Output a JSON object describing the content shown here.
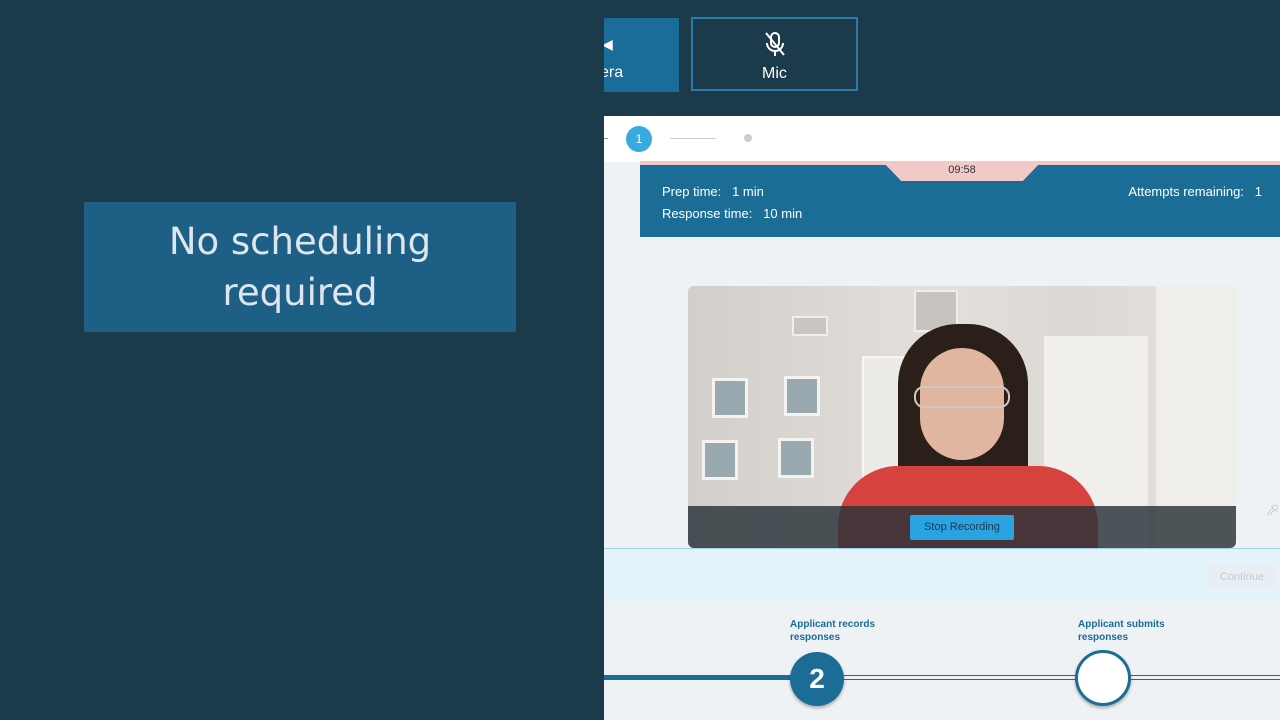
{
  "left": {
    "headline": "No scheduling\nrequired"
  },
  "toolbar": {
    "camera_label": "era",
    "mic_label": "Mic"
  },
  "stepper": {
    "current": "1"
  },
  "timer": {
    "value": "09:58"
  },
  "info": {
    "prep_label": "Prep time:",
    "prep_value": "1 min",
    "response_label": "Response time:",
    "response_value": "10 min",
    "attempts_label": "Attempts remaining:",
    "attempts_value": "1"
  },
  "video": {
    "stop_label": "Stop Recording"
  },
  "continue": {
    "label": "Continue"
  },
  "timeline": {
    "step2_label": "Applicant records responses",
    "step2_number": "2",
    "step3_label": "Applicant submits responses"
  },
  "colors": {
    "navy": "#1b3a4a",
    "brand_blue": "#1c6d96",
    "accent": "#2aa3e3"
  }
}
